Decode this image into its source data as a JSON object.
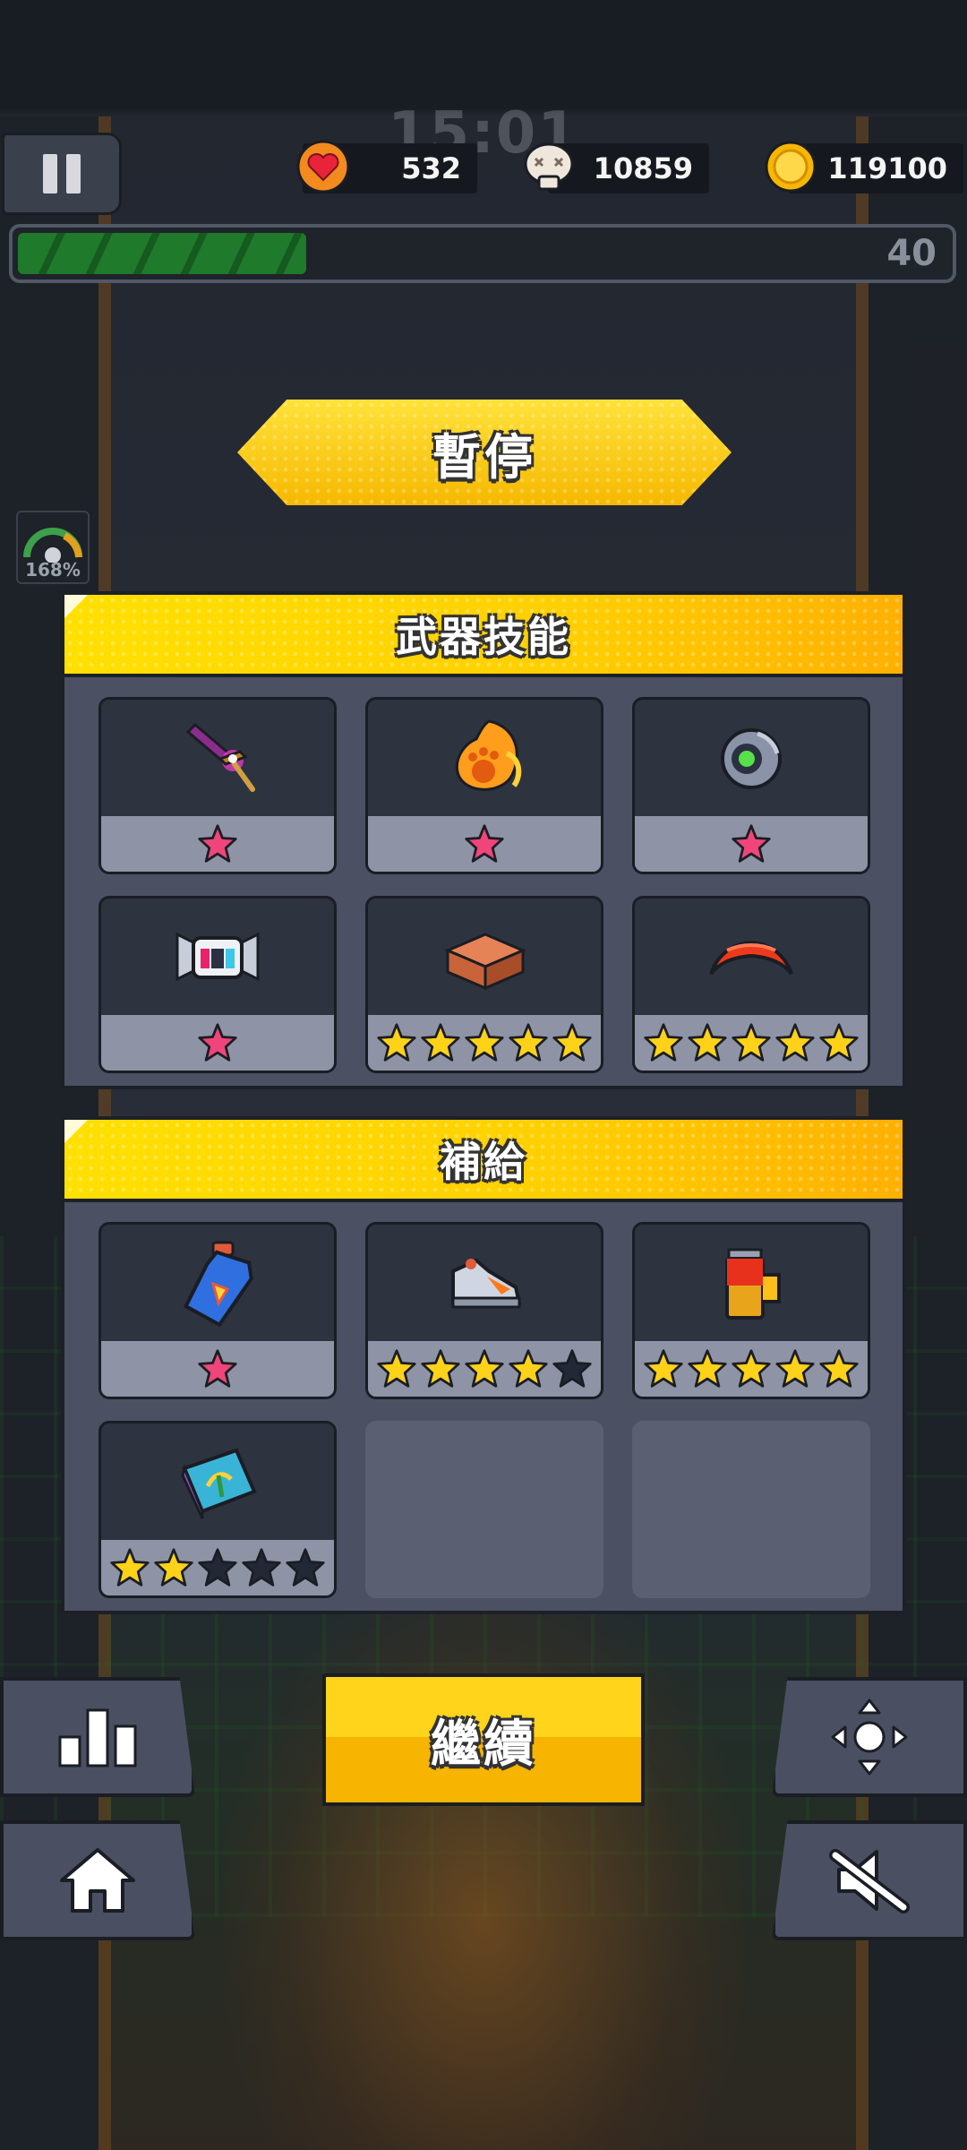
{
  "hud": {
    "timer": "15:01",
    "hp": "532",
    "kills": "10859",
    "gold": "119100",
    "level": "40",
    "xp_progress": 0.31,
    "speed_gauge": "168%"
  },
  "title": "暫停",
  "weapons": {
    "title": "武器技能",
    "slots": [
      {
        "icon": "purple-sword-icon",
        "stars": 1,
        "star_style": "pink"
      },
      {
        "icon": "fire-paw-icon",
        "stars": 1,
        "star_style": "pink"
      },
      {
        "icon": "eyeball-drone-icon",
        "stars": 1,
        "star_style": "pink"
      },
      {
        "icon": "robot-helmet-icon",
        "stars": 1,
        "star_style": "pink"
      },
      {
        "icon": "brick-icon",
        "stars": 5,
        "max": 5,
        "star_style": "gold"
      },
      {
        "icon": "red-boomerang-icon",
        "stars": 5,
        "max": 5,
        "star_style": "gold"
      }
    ]
  },
  "supply": {
    "title": "補給",
    "slots": [
      {
        "icon": "potion-bottle-icon",
        "stars": 1,
        "star_style": "pink"
      },
      {
        "icon": "sneaker-icon",
        "stars": 4,
        "max": 5,
        "star_style": "gold"
      },
      {
        "icon": "battery-icon",
        "stars": 5,
        "max": 5,
        "star_style": "gold"
      },
      {
        "icon": "book-icon",
        "stars": 2,
        "max": 5,
        "star_style": "gold"
      },
      null,
      null
    ]
  },
  "buttons": {
    "continue": "繼續"
  },
  "colors": {
    "gold_star": "#ffd21a",
    "pink_star": "#f0457a",
    "empty_star": "#232836",
    "accent_yellow": "#ffcf00",
    "xp_green": "#1f7a2b"
  }
}
